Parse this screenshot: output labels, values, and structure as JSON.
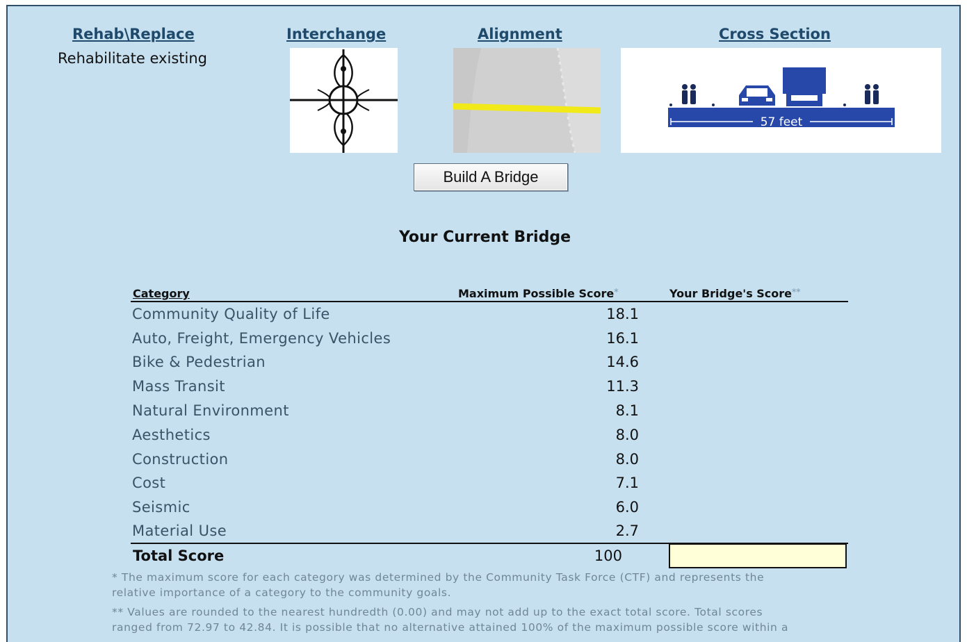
{
  "options": {
    "rehab": {
      "header": "Rehab\\Replace",
      "value": "Rehabilitate existing"
    },
    "interchange": {
      "header": "Interchange"
    },
    "alignment": {
      "header": "Alignment"
    },
    "cross_section": {
      "header": "Cross Section",
      "width_label": "57 feet"
    }
  },
  "build_button": "Build A Bridge",
  "current_title": "Your Current Bridge",
  "table": {
    "col_category": "Category",
    "col_max": "Maximum Possible Score",
    "col_max_mark": "*",
    "col_yours": "Your Bridge's Score",
    "col_yours_mark": "**",
    "rows": [
      {
        "category": "Community Quality of Life",
        "max": "18.1"
      },
      {
        "category": "Auto, Freight, Emergency Vehicles",
        "max": "16.1"
      },
      {
        "category": "Bike & Pedestrian",
        "max": "14.6"
      },
      {
        "category": "Mass Transit",
        "max": "11.3"
      },
      {
        "category": "Natural Environment",
        "max": "8.1"
      },
      {
        "category": "Aesthetics",
        "max": "8.0"
      },
      {
        "category": "Construction",
        "max": "8.0"
      },
      {
        "category": "Cost",
        "max": "7.1"
      },
      {
        "category": "Seismic",
        "max": "6.0"
      },
      {
        "category": "Material Use",
        "max": "2.7"
      }
    ],
    "total_label": "Total Score",
    "total_max": "100",
    "total_yours": ""
  },
  "footnotes": {
    "note1_l1": "* The maximum score for each category was determined by the Community Task Force (CTF) and represents the",
    "note1_l2": "relative importance of a category to the community goals.",
    "note2_l1": "** Values are rounded to the nearest hundredth (0.00) and may not add up to the exact total score. Total scores",
    "note2_l2": "ranged from 72.97 to 42.84. It is possible that no alternative attained 100% of the maximum possible score within a"
  },
  "colors": {
    "panel_bg": "#c6e0f0",
    "header_link": "#1f4a6b",
    "total_box": "#ffffd8",
    "alignment_line": "#f2ea18",
    "deck": "#2748a8"
  }
}
